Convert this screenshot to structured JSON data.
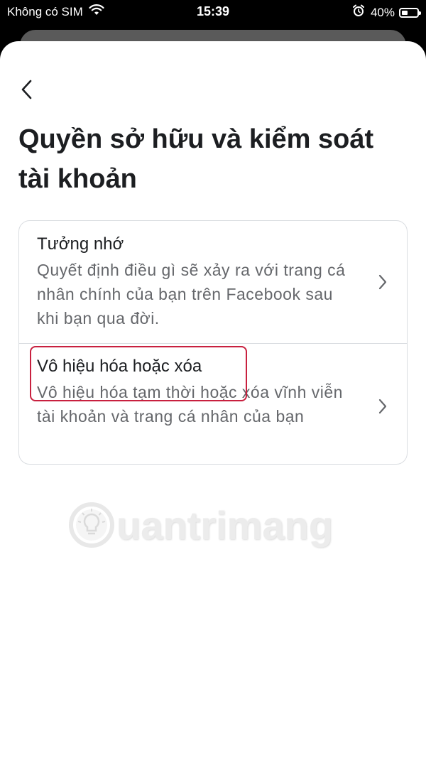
{
  "status_bar": {
    "carrier": "Không có SIM",
    "time": "15:39",
    "battery_percent_text": "40%",
    "battery_level": 0.4
  },
  "header": {
    "title": "Quyền sở hữu và kiểm soát tài khoản"
  },
  "options": [
    {
      "title": "Tưởng nhớ",
      "description": "Quyết định điều gì sẽ xảy ra với trang cá nhân chính của bạn trên Facebook sau khi bạn qua đời."
    },
    {
      "title": "Vô hiệu hóa hoặc xóa",
      "description": "Vô hiệu hóa tạm thời hoặc xóa vĩnh viễn tài khoản và trang cá nhân của bạn",
      "highlighted": true
    }
  ],
  "watermark": {
    "text": "uantrimang"
  },
  "icons": {
    "back": "chevron-left-icon",
    "row_arrow": "chevron-right-icon",
    "wifi": "wifi-icon",
    "alarm": "alarm-icon",
    "battery": "battery-icon"
  },
  "colors": {
    "highlight": "#c8203f",
    "title_text": "#1c1e21",
    "secondary_text": "#65676b",
    "divider": "#dadde1"
  }
}
